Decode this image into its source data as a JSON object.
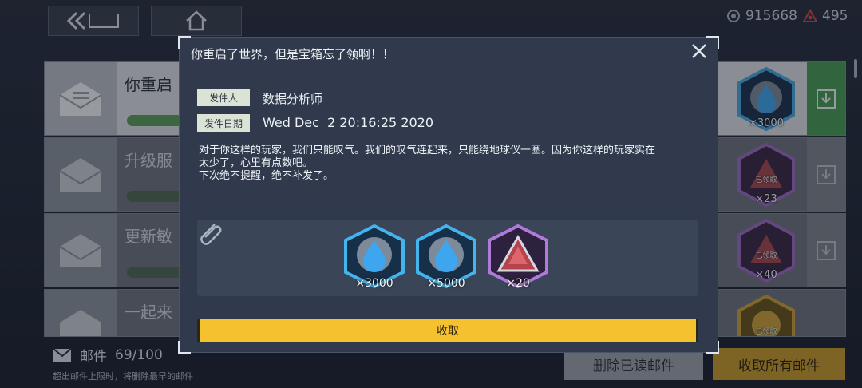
{
  "topbar": {
    "currency_a": "915668",
    "currency_b": "495"
  },
  "mail_list": [
    {
      "title": "你重启",
      "reward_count": "×3000",
      "reward_type": "blue-drop"
    },
    {
      "title": "升级服",
      "reward_count": "×23",
      "reward_type": "red-crystal",
      "claimed": "已领取"
    },
    {
      "title": "更新敏",
      "reward_count": "×40",
      "reward_type": "red-crystal",
      "claimed": "已领取"
    },
    {
      "title": "一起来",
      "reward_count": "",
      "reward_type": "gold",
      "claimed": "已领取"
    }
  ],
  "footer": {
    "mail_label": "邮件",
    "mail_count": "69/100",
    "note": "超出邮件上限时，将删除最早的邮件",
    "delete_read": "删除已读邮件",
    "collect_all": "收取所有邮件"
  },
  "dialog": {
    "title": "你重启了世界，但是宝箱忘了领啊！！",
    "sender_label": "发件人",
    "sender": "数据分析师",
    "date_label": "发件日期",
    "date": "Wed Dec  2 20:16:25 2020",
    "body": "对于你这样的玩家，我们只能叹气。我们的叹气连起来，只能绕地球仪一圈。因为你这样的玩家实在\n太少了，心里有点数吧。\n下次绝不提醒，绝不补发了。",
    "attachments": [
      {
        "type": "blue-drop",
        "count": "×3000"
      },
      {
        "type": "blue-drop",
        "count": "×5000"
      },
      {
        "type": "red-crystal",
        "count": "×20"
      }
    ],
    "collect_label": "收取"
  },
  "colors": {
    "accent_yellow": "#f5c12f",
    "dialog_bg": "#303a4c",
    "green": "#4a9b58"
  }
}
